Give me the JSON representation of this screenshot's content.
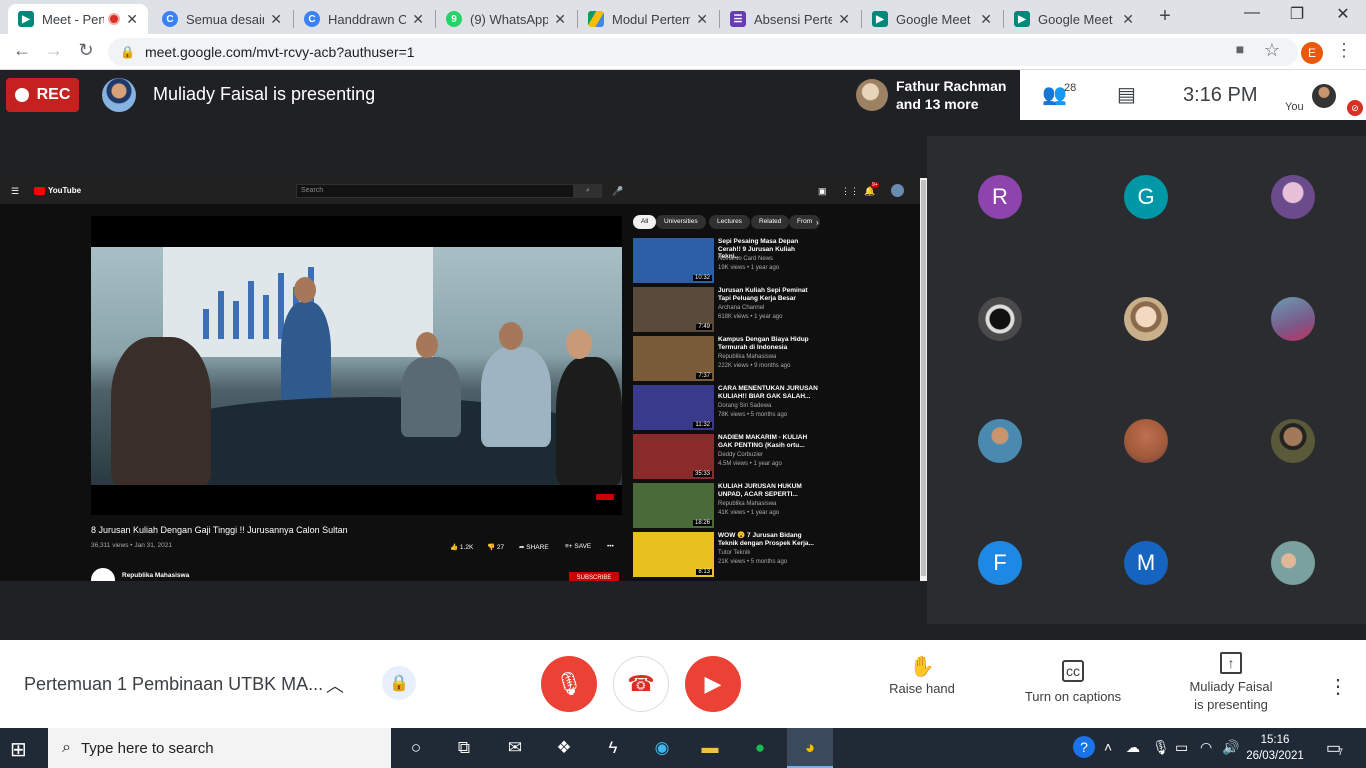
{
  "browser": {
    "tabs": [
      {
        "title": "Meet - Pertemuan 1",
        "icon": "meet-icon",
        "color": "#00897b",
        "active": true,
        "recording": true
      },
      {
        "title": "Semua desain",
        "icon": "canva-icon",
        "color": "#3b82f6"
      },
      {
        "title": "Handdrawn Cl",
        "icon": "canva-icon",
        "color": "#3b82f6"
      },
      {
        "title": "(9) WhatsApp",
        "icon": "whatsapp-icon",
        "color": "#25d366",
        "badge": "9"
      },
      {
        "title": "Modul Pertem",
        "icon": "drive-icon",
        "color": "#fbbc04"
      },
      {
        "title": "Absensi Perten",
        "icon": "forms-icon",
        "color": "#673ab7"
      },
      {
        "title": "Google Meet",
        "icon": "meet-icon",
        "color": "#00897b"
      },
      {
        "title": "Google Meet",
        "icon": "meet-icon",
        "color": "#00897b"
      }
    ],
    "url": "meet.google.com/mvt-rcvy-acb?authuser=1",
    "profile_initial": "E"
  },
  "meet_header": {
    "rec_label": "REC",
    "presenting_text": "Muliady Faisal is presenting",
    "other_participants": "Fathur Rachman and 13 more",
    "people_count": "28",
    "time": "3:16  PM",
    "you_label": "You"
  },
  "youtube": {
    "logo": "YouTube",
    "search_placeholder": "Search",
    "notification_count": "9+",
    "chips": [
      "All",
      "Universities",
      "Lectures",
      "Related",
      "From"
    ],
    "video_title": "8 Jurusan Kuliah Dengan Gaji Tinggi !! Jurusannya Calon Sultan",
    "video_meta": "36,311 views • Jan 31, 2021",
    "likes": "1.2K",
    "dislikes": "27",
    "share": "SHARE",
    "save": "SAVE",
    "channel": "Republika Mahasiswa",
    "subscribe": "SUBSCRIBE",
    "recommendations": [
      {
        "title": "Sepi Pesaing Masa Depan Cerah!! 9 Jurusan Kuliah Tekni...",
        "channel": "Novianto Card News",
        "views": "19K views • 1 year ago",
        "duration": "10:32",
        "thumb_color": "#2b5fa8"
      },
      {
        "title": "Jurusan Kuliah Sepi Peminat Tapi Peluang Kerja Besar",
        "channel": "Archana Channel",
        "views": "618K views • 1 year ago",
        "duration": "7:49",
        "thumb_color": "#5a4a3a"
      },
      {
        "title": "Kampus Dengan Biaya Hidup Termurah di Indonesia",
        "channel": "Republika Mahasiswa",
        "views": "222K views • 9 months ago",
        "duration": "7:37",
        "thumb_color": "#7a5c3a"
      },
      {
        "title": "CARA MENENTUKAN JURUSAN KULIAH!! BIAR GAK SALAH...",
        "channel": "Dorang Siri Sadewa",
        "views": "78K views • 5 months ago",
        "duration": "11:32",
        "thumb_color": "#3a3a8a"
      },
      {
        "title": "NADIEM MAKARIM - KULIAH GAK PENTING (Kasih ortu...",
        "channel": "Deddy Corbuzier",
        "views": "4.5M views • 1 year ago",
        "duration": "35:33",
        "thumb_color": "#8a2a2a"
      },
      {
        "title": "KULIAH JURUSAN HUKUM UNPAD, ACAR SEPERTI...",
        "channel": "Republika Mahasiswa",
        "views": "41K views • 1 year ago",
        "duration": "18:26",
        "thumb_color": "#4a6a3a"
      },
      {
        "title": "WOW 😮 7 Jurusan Bidang Teknik dengan Prospek Kerja...",
        "channel": "Tutor Teknik",
        "views": "21K views • 5 months ago",
        "duration": "8:13",
        "thumb_color": "#e8c020"
      }
    ]
  },
  "participants": [
    {
      "initial": "R",
      "color": "#8e44ad"
    },
    {
      "initial": "G",
      "color": "#0097a7"
    },
    {
      "initial": "",
      "color": "#6a4c8c",
      "photo": true
    },
    {
      "initial": "",
      "color": "#4a4a4a",
      "photo": true
    },
    {
      "initial": "",
      "color": "#c9b08a",
      "photo": true
    },
    {
      "initial": "",
      "color": "#7a5a8a",
      "photo": true
    },
    {
      "initial": "",
      "color": "#4a8ab0",
      "photo": true
    },
    {
      "initial": "",
      "color": "#a05a3a",
      "photo": true
    },
    {
      "initial": "",
      "color": "#3a3a3a",
      "photo": true
    },
    {
      "initial": "F",
      "color": "#1e88e5"
    },
    {
      "initial": "M",
      "color": "#1565c0"
    },
    {
      "initial": "",
      "color": "#7aa0a0",
      "photo": true
    }
  ],
  "bottom_bar": {
    "meeting_title": "Pertemuan 1 Pembinaan UTBK MA...",
    "raise_hand": "Raise hand",
    "captions": "Turn on captions",
    "presenter_line1": "Muliady Faisal",
    "presenter_line2": "is presenting"
  },
  "taskbar": {
    "search_placeholder": "Type here to search",
    "time": "15:16",
    "date": "26/03/2021",
    "notification_count": "7"
  }
}
